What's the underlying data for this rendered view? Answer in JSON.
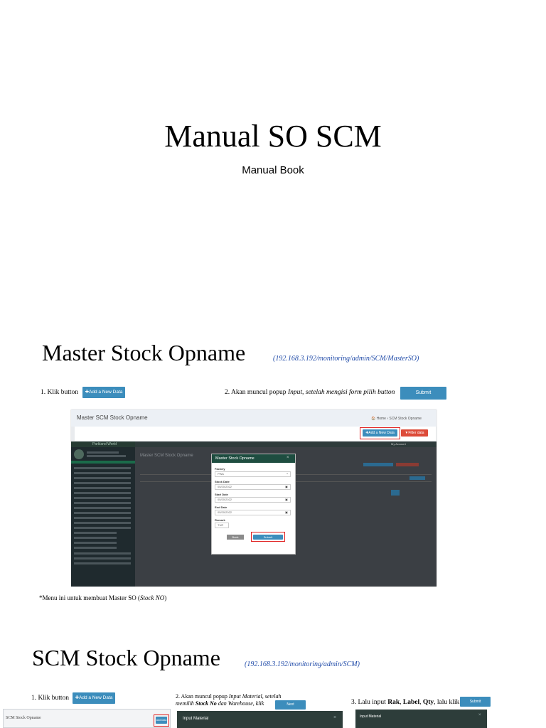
{
  "document": {
    "title": "Manual SO SCM",
    "subtitle": "Manual Book"
  },
  "section1": {
    "title": "Master Stock Opname",
    "url": "(192.168.3.192/monitoring/admin/SCM/MasterSO)",
    "step1_text": "1. Klik button",
    "step1_button": "✚Add a New Data",
    "step2_prefix": "2. Akan muncul popup ",
    "step2_italic": "Input, setelah mengisi form pilih button",
    "step2_button": "Submit",
    "screenshot": {
      "header_title": "Master SCM Stock Opname",
      "breadcrumb": "🏠 Home  ›  SCM Stock Opname",
      "add_button": "✚Add a New Data",
      "filter_button": "▼Filter data",
      "brand": "Parkland World",
      "my_account": "My Account",
      "inner_title": "Master SCM Stock Opname",
      "modal_title": "Master Stock Opname",
      "fields": [
        {
          "label": "Factory",
          "value": "PWA"
        },
        {
          "label": "Stock Date",
          "value": "05/20/2022"
        },
        {
          "label": "Start Date",
          "value": "05/20/2022"
        },
        {
          "label": "End Date",
          "value": "05/20/2022"
        },
        {
          "label": "Remark",
          "value": "TUR"
        }
      ],
      "back_label": "Back",
      "submit_label": "Submit"
    },
    "note_prefix": "*Menu ini untuk membuat Master SO (",
    "note_italic": "Stock NO",
    "note_suffix": ")"
  },
  "section2": {
    "title": "SCM Stock Opname",
    "url": "(192.168.3.192/monitoring/admin/SCM)",
    "step1_text": "1. Klik button",
    "step1_button": "✚Add a New Data",
    "step2_line1_prefix": "2. Akan muncul popup ",
    "step2_line1_italic": "Input Material,",
    "step2_line1_suffix": " setelah",
    "step2_line2_prefix": "memilih ",
    "step2_line2_bold": "Stock No",
    "step2_line2_suffix": " dan Warehouse, klik",
    "step2_button": "Next",
    "step3_prefix": "3. Lalu input ",
    "step3_bold1": "Rak",
    "step3_bold2": "Label",
    "step3_bold3": "Qty",
    "step3_suffix": ", lalu klik",
    "step3_button": "Submit",
    "shot_a_title": "SCM Stock Opname",
    "shot_a_button": "Add Data",
    "shot_b_title": "Input Material",
    "shot_c_title": "Input Material"
  }
}
